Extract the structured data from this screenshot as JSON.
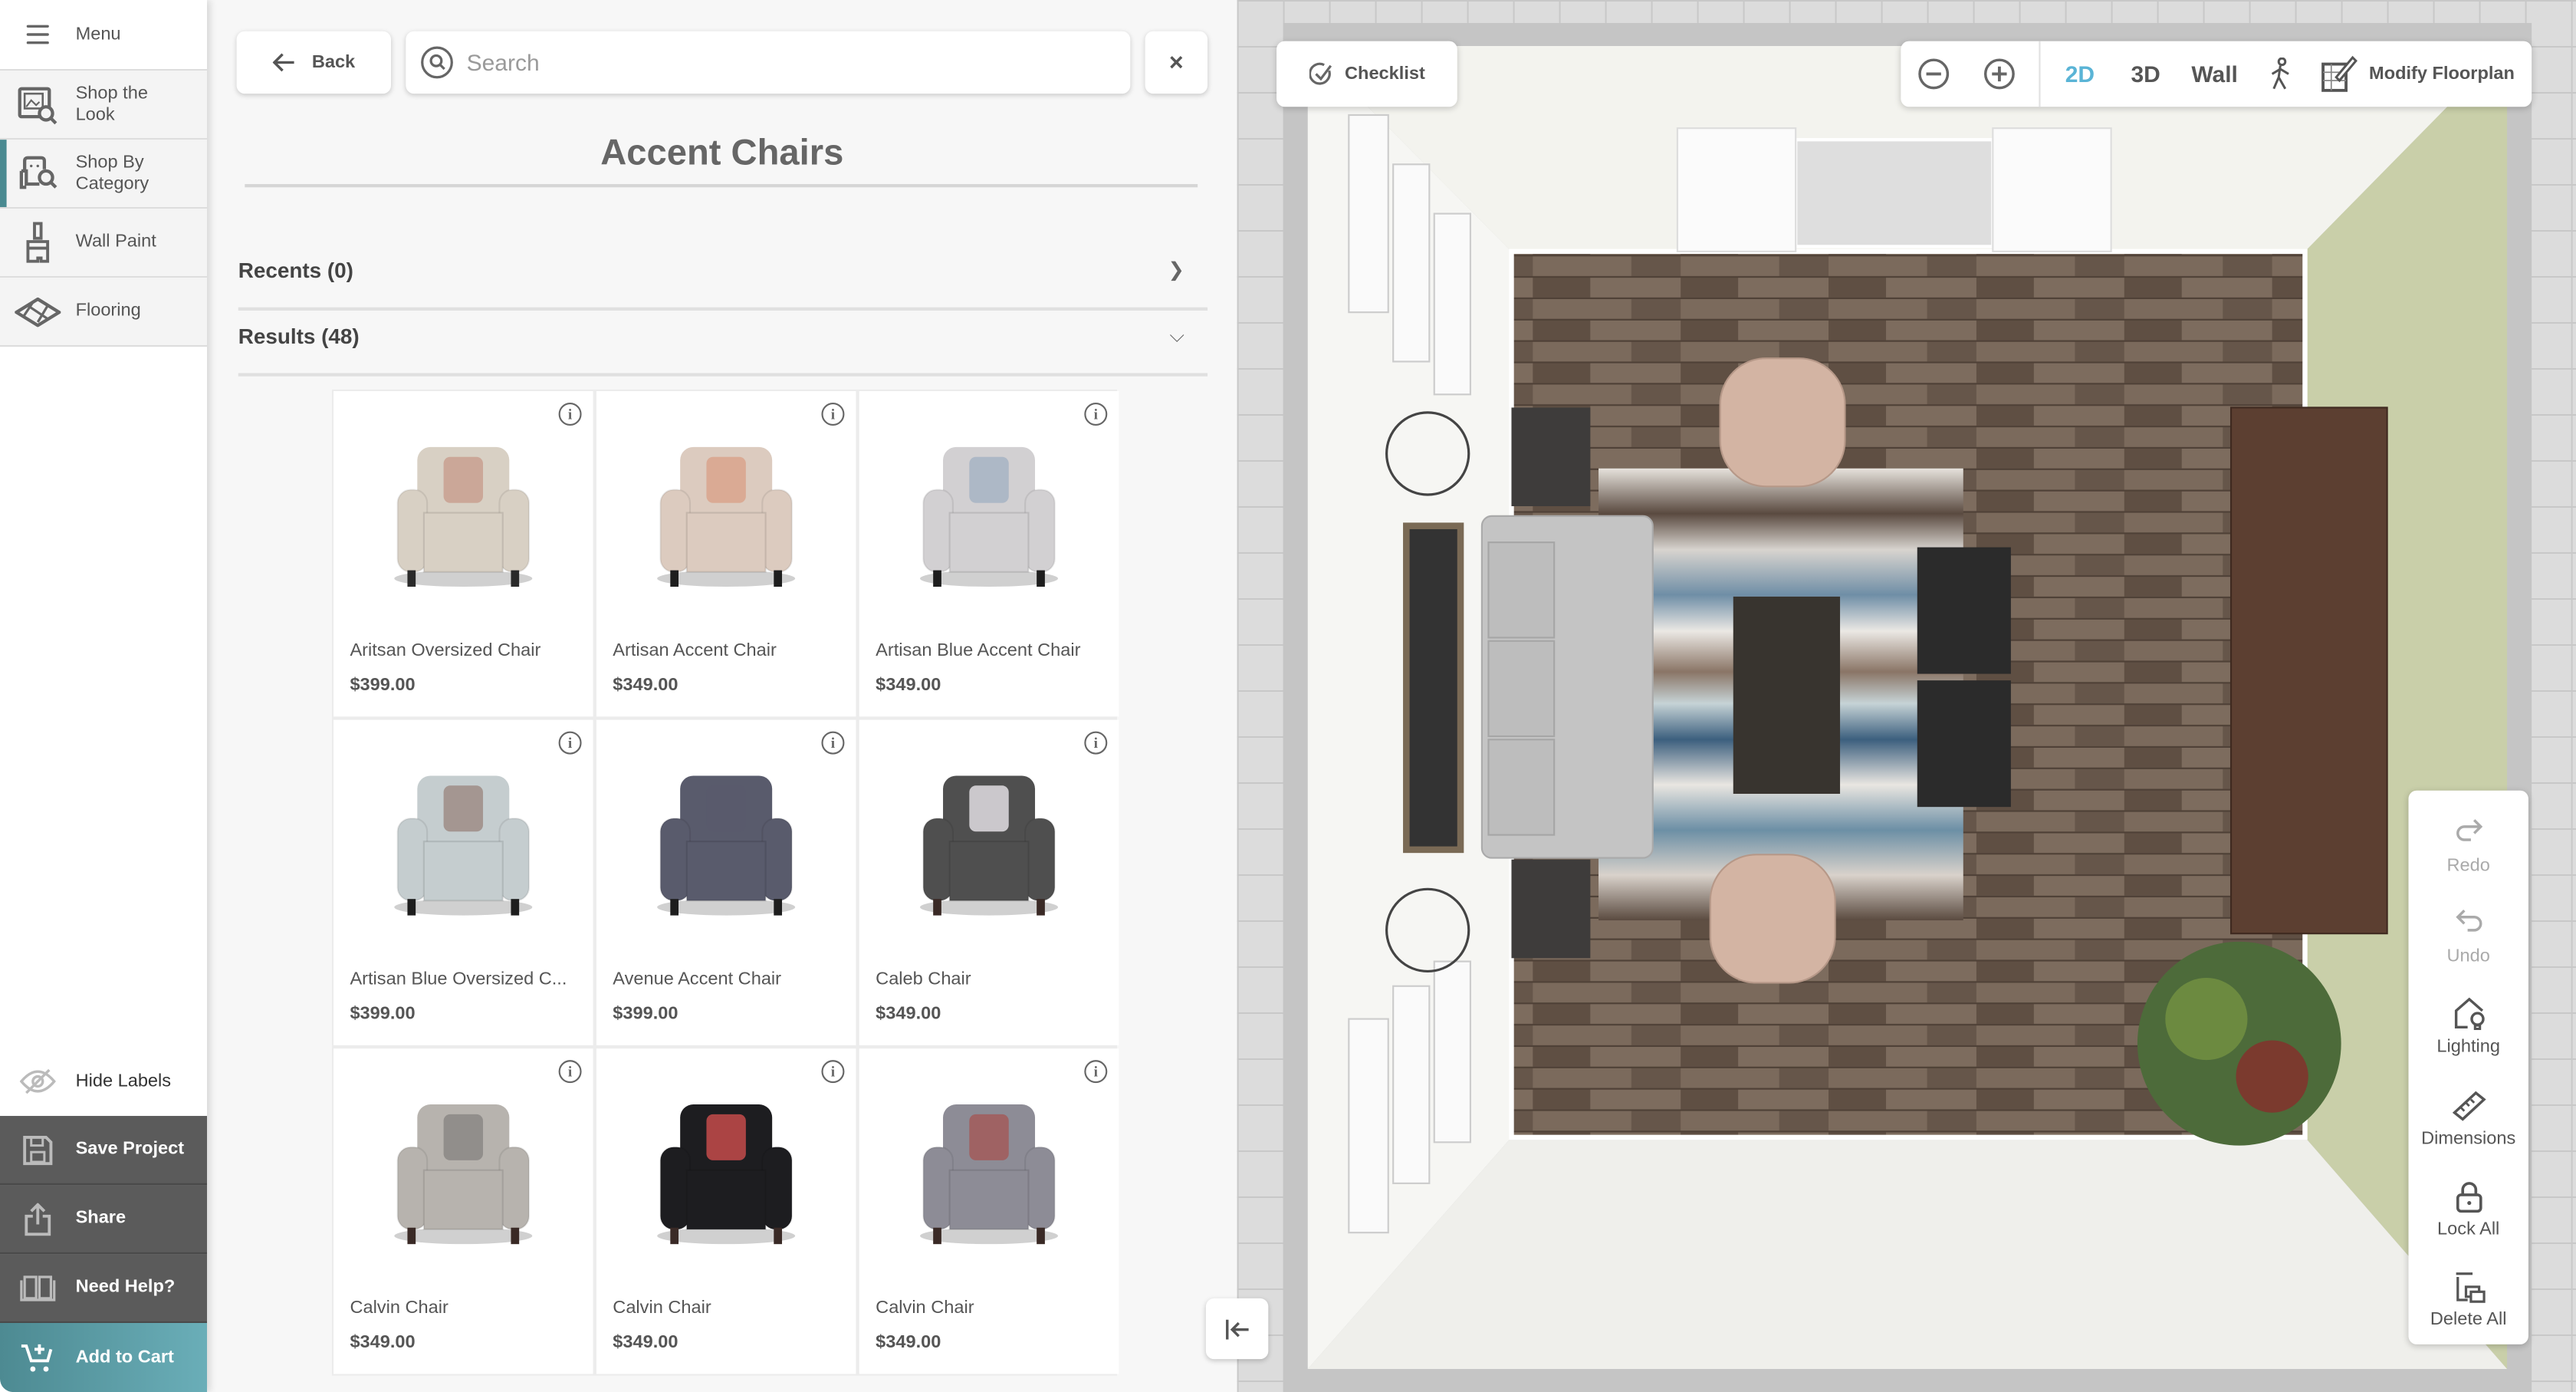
{
  "sidebar": {
    "menu_label": "Menu",
    "items": [
      {
        "label_line1": "Shop the",
        "label_line2": "Look",
        "icon": "shop-the-look-icon",
        "active": false
      },
      {
        "label_line1": "Shop By",
        "label_line2": "Category",
        "icon": "shop-by-category-icon",
        "active": true
      },
      {
        "label_line1": "Wall Paint",
        "label_line2": "",
        "icon": "paint-brush-icon",
        "active": false
      },
      {
        "label_line1": "Flooring",
        "label_line2": "",
        "icon": "flooring-icon",
        "active": false
      }
    ],
    "hide_labels": "Hide Labels",
    "save_project": "Save Project",
    "share": "Share",
    "need_help": "Need Help?",
    "add_to_cart": "Add to Cart",
    "accent_color": "#4a8a91"
  },
  "catalog": {
    "back_label": "Back",
    "search_placeholder": "Search",
    "search_value": "",
    "close_label": "×",
    "category_title": "Accent Chairs",
    "recents_label": "Recents (0)",
    "results_label": "Results (48)",
    "products": [
      {
        "name": "Aritsan Oversized Chair",
        "price": "$399.00",
        "body": "#d8d0c4",
        "pillow": "#c9a090",
        "legs": "#2a2a2a"
      },
      {
        "name": "Artisan Accent Chair",
        "price": "$349.00",
        "body": "#dccbbf",
        "pillow": "#d9a58c",
        "legs": "#1e1e1e"
      },
      {
        "name": "Artisan Blue Accent Chair",
        "price": "$349.00",
        "body": "#d2d0d2",
        "pillow": "#a7b4c4",
        "legs": "#1e1e1e"
      },
      {
        "name": "Artisan Blue Oversized C...",
        "price": "$399.00",
        "body": "#c5cdcf",
        "pillow": "#9d8c86",
        "legs": "#1e1e1e"
      },
      {
        "name": "Avenue Accent Chair",
        "price": "$399.00",
        "body": "#595b6c",
        "pillow": "#595b6c",
        "legs": "#1e1e1e"
      },
      {
        "name": "Caleb Chair",
        "price": "$349.00",
        "body": "#4f4f4f",
        "pillow": "#e0dde2",
        "legs": "#3a2a26"
      },
      {
        "name": "Calvin Chair",
        "price": "$349.00",
        "body": "#b7b3ae",
        "pillow": "#8b8785",
        "legs": "#3a2a26"
      },
      {
        "name": "Calvin Chair",
        "price": "$349.00",
        "body": "#1d1d20",
        "pillow": "#c44b4b",
        "legs": "#3a2a26"
      },
      {
        "name": "Calvin Chair",
        "price": "$349.00",
        "body": "#8d8c96",
        "pillow": "#a25a5a",
        "legs": "#3a2a26"
      }
    ]
  },
  "canvas": {
    "checklist_label": "Checklist",
    "view_modes": [
      "2D",
      "3D",
      "Wall"
    ],
    "active_view": "2D",
    "active_color": "#5ab4d6",
    "modify_floorplan_label": "Modify Floorplan",
    "tools": [
      {
        "label": "Redo",
        "disabled": true
      },
      {
        "label": "Undo",
        "disabled": true
      },
      {
        "label": "Lighting",
        "disabled": false
      },
      {
        "label": "Dimensions",
        "disabled": false
      },
      {
        "label": "Lock All",
        "disabled": false
      },
      {
        "label": "Delete All",
        "disabled": false
      }
    ]
  }
}
